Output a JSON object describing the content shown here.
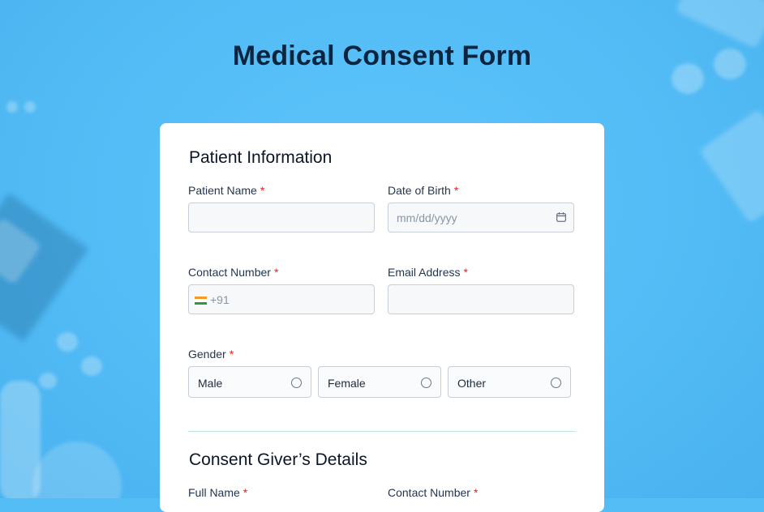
{
  "page": {
    "title": "Medical Consent Form"
  },
  "patient_section": {
    "title": "Patient Information",
    "patient_name": {
      "label": "Patient Name",
      "required": "*",
      "value": ""
    },
    "dob": {
      "label": "Date of Birth",
      "required": "*",
      "placeholder": "mm/dd/yyyy"
    },
    "contact": {
      "label": "Contact Number",
      "required": "*",
      "prefix": "+91",
      "flag": "india-flag-icon"
    },
    "email": {
      "label": "Email Address",
      "required": "*",
      "value": ""
    },
    "gender": {
      "label": "Gender",
      "required": "*",
      "options": [
        "Male",
        "Female",
        "Other"
      ]
    }
  },
  "consent_section": {
    "title": "Consent Giver’s Details",
    "full_name": {
      "label": "Full Name",
      "required": "*"
    },
    "contact": {
      "label": "Contact Number",
      "required": "*"
    }
  },
  "colors": {
    "background": "#55bdf6",
    "title": "#0b2440",
    "required": "#e02424",
    "divider": "#bfe3e6"
  }
}
